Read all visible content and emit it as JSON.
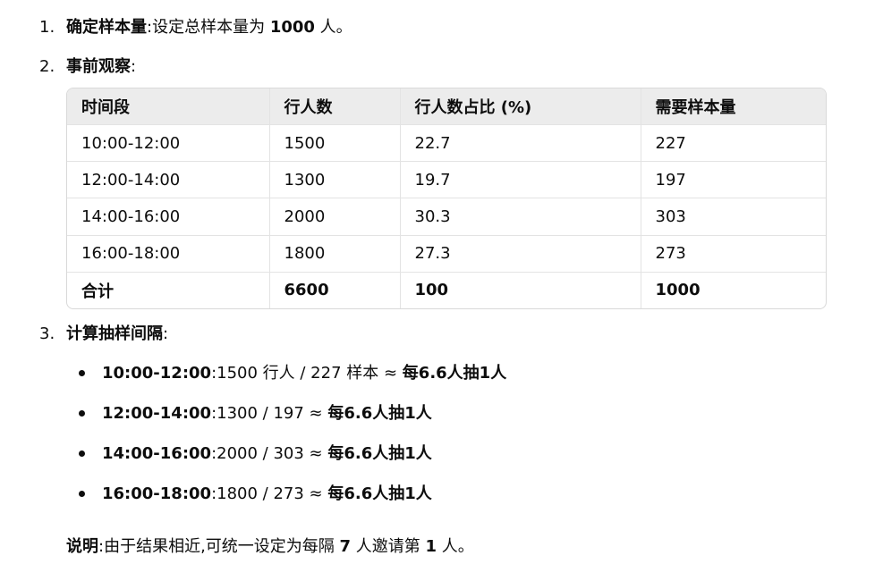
{
  "list": [
    {
      "num": "1.",
      "title": "确定样本量",
      "sep": ":",
      "pre": "设定总样本量为 ",
      "value": "1000",
      "post": " 人。"
    },
    {
      "num": "2.",
      "title": "事前观察",
      "sep": ":"
    },
    {
      "num": "3.",
      "title": "计算抽样间隔",
      "sep": ":"
    }
  ],
  "table": {
    "headers": [
      "时间段",
      "行人数",
      "行人数占比 (%)",
      "需要样本量"
    ],
    "rows": [
      [
        "10:00-12:00",
        "1500",
        "22.7",
        "227"
      ],
      [
        "12:00-14:00",
        "1300",
        "19.7",
        "197"
      ],
      [
        "14:00-16:00",
        "2000",
        "30.3",
        "303"
      ],
      [
        "16:00-18:00",
        "1800",
        "27.3",
        "273"
      ]
    ],
    "total": [
      "合计",
      "6600",
      "100",
      "1000"
    ]
  },
  "intervals": [
    {
      "period": "10:00-12:00",
      "sep": ":",
      "calc": "1500 行人 / 227 样本 ≈ ",
      "result": "每6.6人抽1人"
    },
    {
      "period": "12:00-14:00",
      "sep": ":",
      "calc": "1300 / 197 ≈ ",
      "result": "每6.6人抽1人"
    },
    {
      "period": "14:00-16:00",
      "sep": ":",
      "calc": "2000 / 303 ≈ ",
      "result": "每6.6人抽1人"
    },
    {
      "period": "16:00-18:00",
      "sep": ":",
      "calc": "1800 / 273 ≈ ",
      "result": "每6.6人抽1人"
    }
  ],
  "note": {
    "label": "说明",
    "sep": ":",
    "text1": "由于结果相近,可统一设定为每隔 ",
    "n1": "7",
    "text2": " 人邀请第 ",
    "n2": "1",
    "text3": " 人。"
  }
}
